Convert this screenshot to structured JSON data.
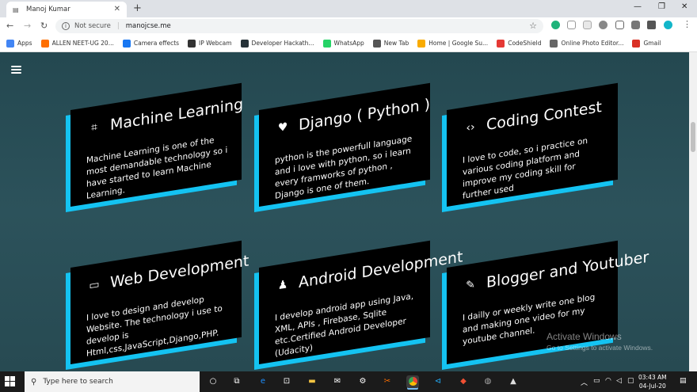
{
  "browser": {
    "tab_title": "Manoj Kumar",
    "security_label": "Not secure",
    "url": "manojcse.me",
    "bookmarks": [
      {
        "label": "Apps",
        "color": "#4285f4"
      },
      {
        "label": "ALLEN NEET-UG 20...",
        "color": "#ff6f00"
      },
      {
        "label": "Camera effects",
        "color": "#1877f2"
      },
      {
        "label": "IP Webcam",
        "color": "#333333"
      },
      {
        "label": "Developer Hackath...",
        "color": "#263238"
      },
      {
        "label": "WhatsApp",
        "color": "#25d366"
      },
      {
        "label": "New Tab",
        "color": "#555555"
      },
      {
        "label": "Home | Google Su...",
        "color": "#f9ab00"
      },
      {
        "label": "CodeShield",
        "color": "#e53935"
      },
      {
        "label": "Online Photo Editor...",
        "color": "#666666"
      },
      {
        "label": "Gmail",
        "color": "#d93025"
      }
    ]
  },
  "page": {
    "accent_color": "#14c3f2",
    "cards": [
      {
        "icon": "⌗",
        "title": "Machine Learning",
        "desc": "Machine Learning is one of the most demandable technology so i have started to learn Machine Learning."
      },
      {
        "icon": "♥",
        "title": "Django ( Python )",
        "desc": "python is the powerfull language and i love with python, so i learn every framworks of python , Django is one of them."
      },
      {
        "icon": "‹›",
        "title": "Coding Contest",
        "desc": "I love to code, so i practice on various coding platform and improve my coding skill for further used"
      },
      {
        "icon": "▭",
        "title": "Web Development",
        "desc": "I love to design and develop Website. The technology i use to develop is Html,css,JavaScript,Django,PHP."
      },
      {
        "icon": "♟",
        "title": "Android Development",
        "desc": "I develop android app using Java, XML, APIs , Firebase, Sqlite etc.Certified Android Developer (Udacity)"
      },
      {
        "icon": "✎",
        "title": "Blogger and Youtuber",
        "desc": "I dailly or weekly write one blog and making one video for my youtube channel."
      }
    ]
  },
  "watermark": {
    "line1": "Activate Windows",
    "line2": "Go to Settings to activate Windows."
  },
  "taskbar": {
    "search_placeholder": "Type here to search",
    "time": "03:43 AM",
    "date": "04-Jul-20"
  }
}
